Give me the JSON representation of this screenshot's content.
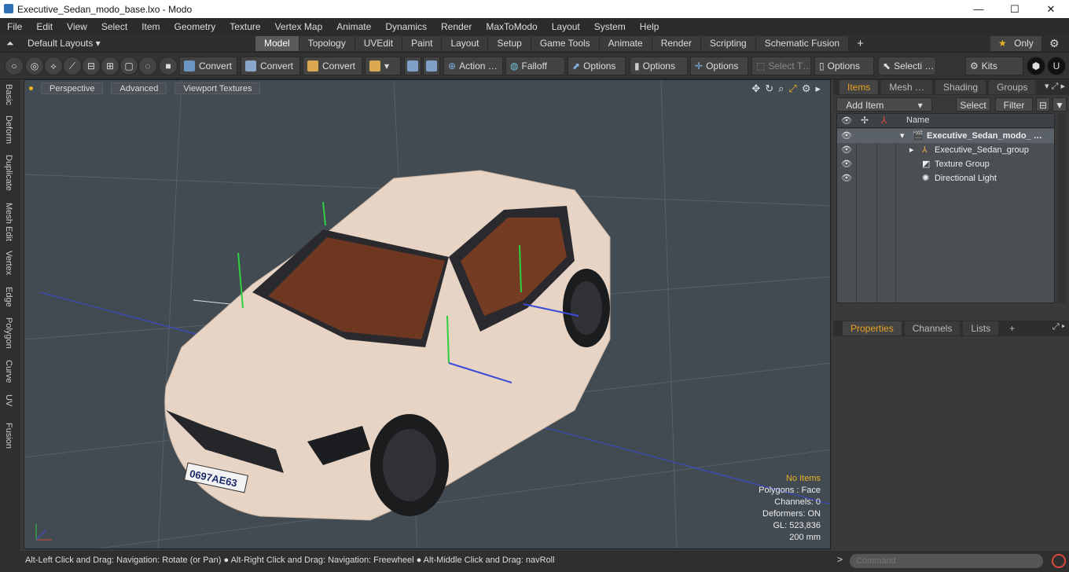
{
  "window": {
    "title": "Executive_Sedan_modo_base.lxo - Modo",
    "min": "—",
    "max": "☐",
    "close": "✕"
  },
  "menu": [
    "File",
    "Edit",
    "View",
    "Select",
    "Item",
    "Geometry",
    "Texture",
    "Vertex Map",
    "Animate",
    "Dynamics",
    "Render",
    "MaxToModo",
    "Layout",
    "System",
    "Help"
  ],
  "layouts": {
    "label": "Default Layouts ▾"
  },
  "mode_tabs": [
    "Model",
    "Topology",
    "UVEdit",
    "Paint",
    "Layout",
    "Setup",
    "Game Tools",
    "Animate",
    "Render",
    "Scripting",
    "Schematic Fusion"
  ],
  "active_mode": "Model",
  "plus": "+",
  "only": {
    "star": "★",
    "label": "Only"
  },
  "gear": "⚙",
  "toolbar": {
    "convert1": "Convert",
    "convert2": "Convert",
    "convert3": "Convert",
    "action": "Action  …",
    "falloff": "Falloff",
    "options1": "Options",
    "options2": "Options",
    "options3": "Options",
    "select_t": "Select T…",
    "options4": "Options",
    "selecti": "Selecti …",
    "kits": "Kits"
  },
  "sidebar": [
    "Basic",
    "Deform",
    "Duplicate",
    "Mesh Edit",
    "Vertex",
    "Edge",
    "Polygon",
    "Curve",
    "UV",
    "Fusion"
  ],
  "viewport": {
    "perspective": "Perspective",
    "advanced": "Advanced",
    "textures": "Viewport Textures",
    "info": {
      "items": "No Items",
      "polygons": "Polygons : Face",
      "channels": "Channels: 0",
      "deformers": "Deformers: ON",
      "gl": "GL: 523,836",
      "scale": "200 mm"
    },
    "plate": "0697AE63"
  },
  "status": "Alt-Left Click and Drag: Navigation: Rotate (or Pan) ● Alt-Right Click and Drag: Navigation: Freewheel ● Alt-Middle Click and Drag: navRoll",
  "command": {
    "prompt": ">",
    "placeholder": "Command"
  },
  "panel_top": {
    "tabs": [
      "Items",
      "Mesh …",
      "Shading",
      "Groups"
    ],
    "add_item": "Add Item",
    "select": "Select",
    "filter": "Filter",
    "name_header": "Name",
    "rows": [
      {
        "label": "Executive_Sedan_modo_ …",
        "bold": true
      },
      {
        "label": "Executive_Sedan_group"
      },
      {
        "label": "Texture Group"
      },
      {
        "label": "Directional Light"
      }
    ]
  },
  "panel_bottom": {
    "tabs": [
      "Properties",
      "Channels",
      "Lists"
    ],
    "plus": "+"
  }
}
